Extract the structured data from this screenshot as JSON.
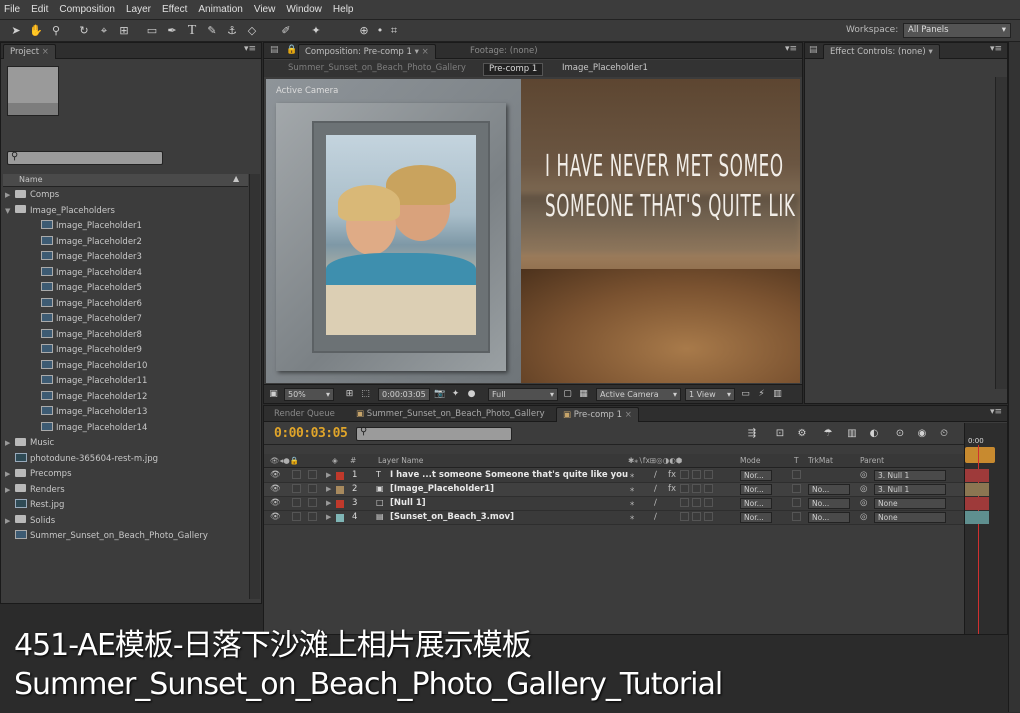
{
  "menubar": [
    "File",
    "Edit",
    "Composition",
    "Layer",
    "Effect",
    "Animation",
    "View",
    "Window",
    "Help"
  ],
  "workspace": {
    "label": "Workspace:",
    "value": "All Panels"
  },
  "project": {
    "tab": "Project",
    "column_name": "Name",
    "items": [
      {
        "type": "folder",
        "label": "Comps",
        "open": false
      },
      {
        "type": "folder",
        "label": "Image_Placeholders",
        "open": true
      },
      {
        "type": "comp",
        "label": "Image_Placeholder1",
        "indent": 1
      },
      {
        "type": "comp",
        "label": "Image_Placeholder2",
        "indent": 1
      },
      {
        "type": "comp",
        "label": "Image_Placeholder3",
        "indent": 1
      },
      {
        "type": "comp",
        "label": "Image_Placeholder4",
        "indent": 1
      },
      {
        "type": "comp",
        "label": "Image_Placeholder5",
        "indent": 1
      },
      {
        "type": "comp",
        "label": "Image_Placeholder6",
        "indent": 1
      },
      {
        "type": "comp",
        "label": "Image_Placeholder7",
        "indent": 1
      },
      {
        "type": "comp",
        "label": "Image_Placeholder8",
        "indent": 1
      },
      {
        "type": "comp",
        "label": "Image_Placeholder9",
        "indent": 1
      },
      {
        "type": "comp",
        "label": "Image_Placeholder10",
        "indent": 1
      },
      {
        "type": "comp",
        "label": "Image_Placeholder11",
        "indent": 1
      },
      {
        "type": "comp",
        "label": "Image_Placeholder12",
        "indent": 1
      },
      {
        "type": "comp",
        "label": "Image_Placeholder13",
        "indent": 1
      },
      {
        "type": "comp",
        "label": "Image_Placeholder14",
        "indent": 1
      },
      {
        "type": "folder",
        "label": "Music",
        "open": false
      },
      {
        "type": "image",
        "label": "photodune-365604-rest-m.jpg"
      },
      {
        "type": "folder",
        "label": "Precomps",
        "open": false
      },
      {
        "type": "folder",
        "label": "Renders",
        "open": false
      },
      {
        "type": "image",
        "label": "Rest.jpg"
      },
      {
        "type": "folder",
        "label": "Solids",
        "open": false
      },
      {
        "type": "comp",
        "label": "Summer_Sunset_on_Beach_Photo_Gallery"
      }
    ]
  },
  "composition": {
    "tab": "Composition: Pre-comp 1",
    "footage_tab": "Footage: (none)",
    "breadcrumbs": [
      "Summer_Sunset_on_Beach_Photo_Gallery",
      "Pre-comp 1",
      "Image_Placeholder1"
    ],
    "active_camera": "Active Camera",
    "title_line1": "I HAVE NEVER MET SOMEO",
    "title_line2": "SOMEONE THAT'S QUITE LIK",
    "zoom": "50%",
    "timecode": "0:00:03:05",
    "resolution": "Full",
    "view": "Active Camera",
    "views": "1 View"
  },
  "effects": {
    "tab": "Effect Controls: (none)"
  },
  "timeline": {
    "tabs": [
      "Render Queue",
      "Summer_Sunset_on_Beach_Photo_Gallery",
      "Pre-comp 1"
    ],
    "timecode": "0:00:03:05",
    "ruler_label": "0:00",
    "columns": {
      "layer_name": "Layer Name",
      "mode": "Mode",
      "t": "T",
      "trkmat": "TrkMat",
      "parent": "Parent"
    },
    "layers": [
      {
        "num": "1",
        "name": "I have ...t someone Someone that's quite like you",
        "label_color": "#c0392b",
        "mode": "Nor...",
        "trkmat": "",
        "parent": "3. Null 1",
        "bar_color": "#9e3a3a",
        "icon": "T"
      },
      {
        "num": "2",
        "name": "[Image_Placeholder1]",
        "label_color": "#a88a5e",
        "mode": "Nor...",
        "trkmat": "No...",
        "parent": "3. Null 1",
        "bar_color": "#8b7652",
        "icon": "comp"
      },
      {
        "num": "3",
        "name": "[Null 1]",
        "label_color": "#c0392b",
        "mode": "Nor...",
        "trkmat": "No...",
        "parent": "None",
        "bar_color": "#9e3a3a",
        "icon": "null"
      },
      {
        "num": "4",
        "name": "[Sunset_on_Beach_3.mov]",
        "label_color": "#7fb5b5",
        "mode": "Nor...",
        "trkmat": "No...",
        "parent": "None",
        "bar_color": "#5f8f8f",
        "icon": "mov"
      }
    ]
  },
  "subtitle": {
    "line1": "451-AE模板-日落下沙滩上相片展示模板",
    "line2": "Summer_Sunset_on_Beach_Photo_Gallery_Tutorial"
  }
}
